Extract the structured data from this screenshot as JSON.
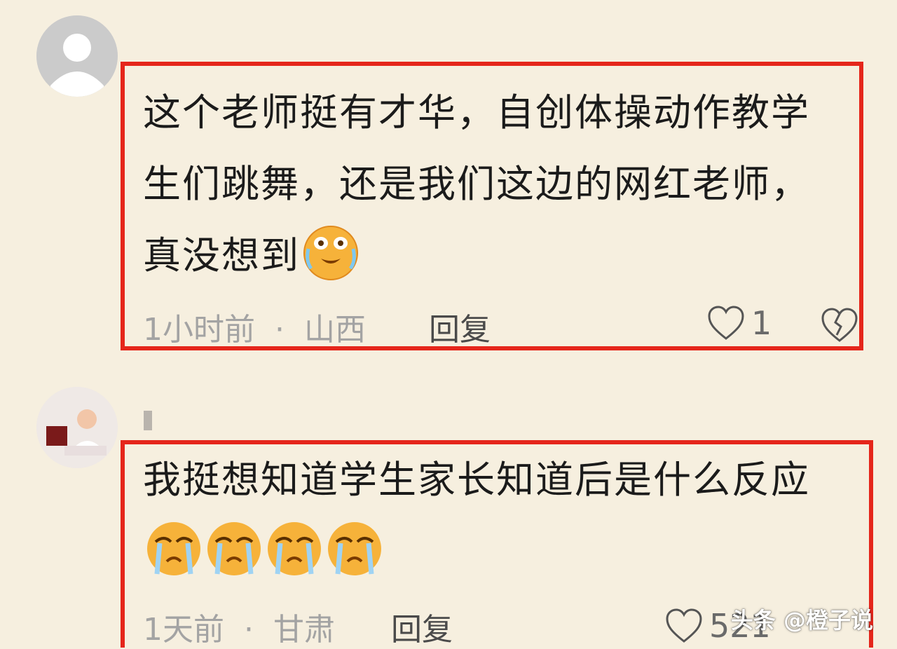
{
  "comments": [
    {
      "avatar_icon": "default-user-avatar-icon",
      "text": "这个老师挺有才华，自创体操动作教学生们跳舞，还是我们这边的网红老师，真没想到",
      "emoji": [
        "crying-laughing-emoji"
      ],
      "time": "1小时前",
      "separator": "·",
      "location": "山西",
      "reply_label": "回复",
      "like_count": "1",
      "like_icon": "heart-outline-icon",
      "dislike_icon": "broken-heart-icon"
    },
    {
      "avatar_icon": "user-photo-avatar-icon",
      "text": "我挺想知道学生家长知道后是什么反应",
      "emoji": [
        "crying-emoji",
        "crying-emoji",
        "crying-emoji",
        "crying-emoji"
      ],
      "time": "1天前",
      "separator": "·",
      "location": "甘肃",
      "reply_label": "回复",
      "like_count": "521",
      "like_icon": "heart-outline-icon"
    }
  ],
  "watermark": "头条 @橙子说",
  "colors": {
    "background": "#f6efdf",
    "highlight_border": "#e5261b",
    "meta_text": "#a3a3a3"
  }
}
